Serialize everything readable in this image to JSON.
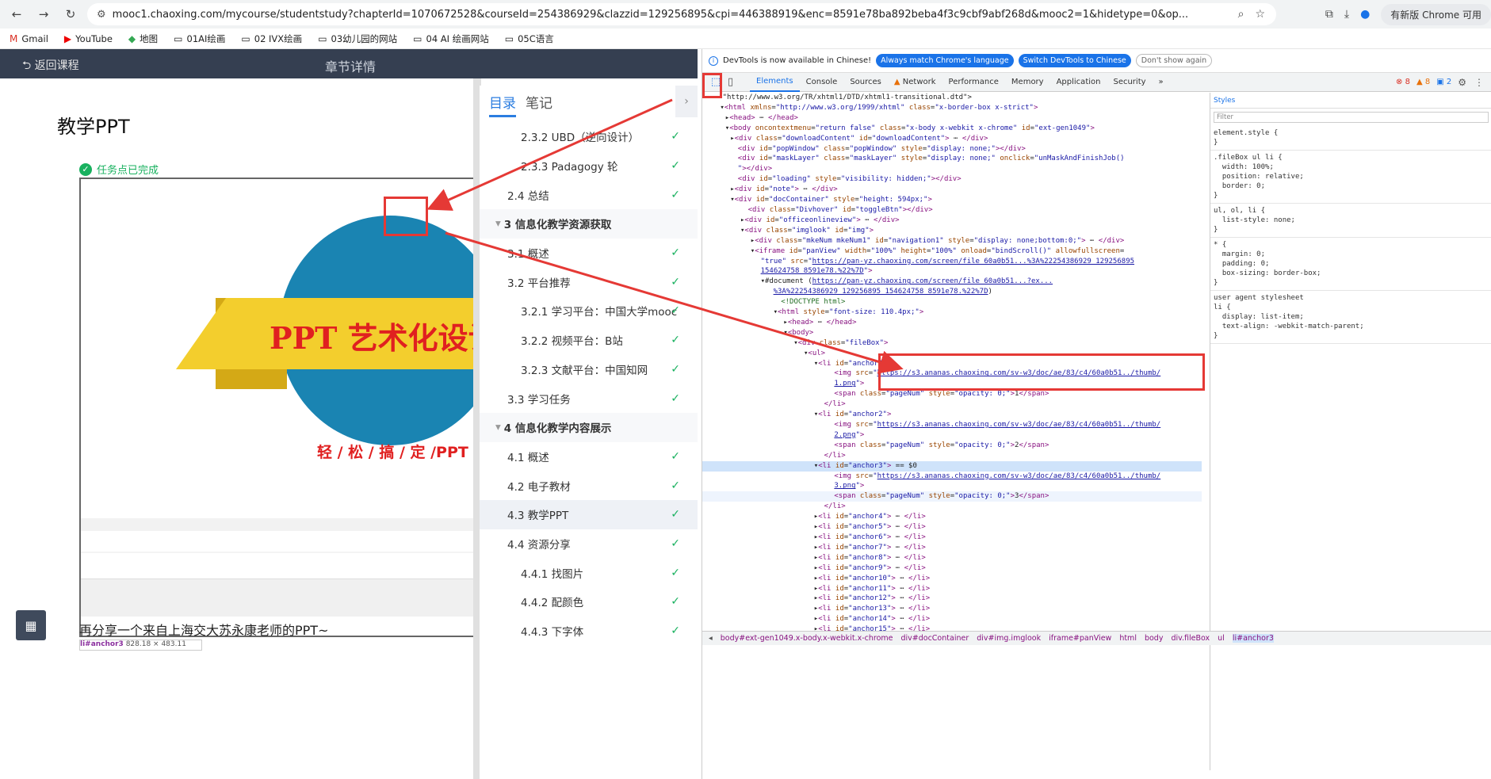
{
  "browser": {
    "url": "mooc1.chaoxing.com/mycourse/studentstudy?chapterId=1070672528&courseId=254386929&clazzid=129256895&cpi=446388919&enc=8591e78ba892beba4f3c9cbf9abf268d&mooc2=1&hidetype=0&op...",
    "chrome_update": "有新版 Chrome 可用",
    "bookmarks": [
      "Gmail",
      "YouTube",
      "地图",
      "01AI绘画",
      "02 IVX绘画",
      "03幼儿园的网站",
      "04 AI 绘画网站",
      "05C语言"
    ]
  },
  "course": {
    "back_label": "返回课程",
    "header_title": "章节详情",
    "page_title": "教学PPT",
    "task_status": "任务点已完成",
    "slide_title": "PPT 艺术化设计",
    "slide_tagline": "轻 / 松 / 搞 / 定 /PPT",
    "next_text": "再分享一个来自上海交大苏永康老师的PPT~",
    "hover_tag_name": "li#anchor3",
    "hover_tag_size": "828.18 × 483.11"
  },
  "catalog": {
    "tab_active": "目录",
    "tab_notes": "笔记",
    "items": [
      {
        "label": "2.3.2 UBD（逆向设计）",
        "level": 3,
        "done": true
      },
      {
        "label": "2.3.3 Padagogy 轮",
        "level": 3,
        "done": true
      },
      {
        "label": "2.4 总结",
        "level": 2,
        "done": true
      },
      {
        "label": "3 信息化教学资源获取",
        "level": 1,
        "done": false
      },
      {
        "label": "3.1 概述",
        "level": 2,
        "done": true
      },
      {
        "label": "3.2 平台推荐",
        "level": 2,
        "done": true
      },
      {
        "label": "3.2.1 学习平台：中国大学mooc",
        "level": 3,
        "done": true
      },
      {
        "label": "3.2.2 视频平台：B站",
        "level": 3,
        "done": true
      },
      {
        "label": "3.2.3 文献平台：中国知网",
        "level": 3,
        "done": true
      },
      {
        "label": "3.3 学习任务",
        "level": 2,
        "done": true
      },
      {
        "label": "4 信息化教学内容展示",
        "level": 1,
        "done": false
      },
      {
        "label": "4.1 概述",
        "level": 2,
        "done": true
      },
      {
        "label": "4.2 电子教材",
        "level": 2,
        "done": true
      },
      {
        "label": "4.3 教学PPT",
        "level": 2,
        "done": true,
        "active": true
      },
      {
        "label": "4.4 资源分享",
        "level": 2,
        "done": true
      },
      {
        "label": "4.4.1 找图片",
        "level": 3,
        "done": true
      },
      {
        "label": "4.4.2 配颜色",
        "level": 3,
        "done": true
      },
      {
        "label": "4.4.3 下字体",
        "level": 3,
        "done": true
      }
    ]
  },
  "devtools": {
    "info_text": "DevTools is now available in Chinese!",
    "btn_match": "Always match Chrome's language",
    "btn_switch": "Switch DevTools to Chinese",
    "btn_dont": "Don't show again",
    "tabs": [
      "Elements",
      "Console",
      "Sources",
      "Network",
      "Performance",
      "Memory",
      "Application",
      "Security"
    ],
    "errors": "8",
    "warnings": "8",
    "infos": "2",
    "styles_tab": "Styles",
    "filter_placeholder": "Filter",
    "breadcrumbs": [
      "body#ext-gen1049.x-body.x-webkit.x-chrome",
      "div#docContainer",
      "div#img.imglook",
      "iframe#panView",
      "html",
      "body",
      "div.fileBox",
      "ul",
      "li#anchor3"
    ],
    "dom_lines": [
      {
        "i": 16,
        "html": "<span class='txt'>\"http://www.w3.org/TR/xhtml1/DTD/xhtml1-transitional.dtd\"&gt;</span>"
      },
      {
        "i": 14,
        "html": "▾<span class='tag'>&lt;html</span> <span class='attr'>xmlns</span>=<span class='val'>\"http://www.w3.org/1999/xhtml\"</span> <span class='attr'>class</span>=<span class='val'>\"x-border-box x-strict\"</span><span class='tag'>&gt;</span>"
      },
      {
        "i": 18,
        "html": "▸<span class='tag'>&lt;head&gt;</span> ⋯ <span class='tag'>&lt;/head&gt;</span>"
      },
      {
        "i": 18,
        "html": "▾<span class='tag'>&lt;body</span> <span class='attr'>oncontextmenu</span>=<span class='val'>\"return false\"</span> <span class='attr'>class</span>=<span class='val'>\"x-body x-webkit x-chrome\"</span> <span class='attr'>id</span>=<span class='val'>\"ext-gen1049\"</span><span class='tag'>&gt;</span>"
      },
      {
        "i": 22,
        "html": "▸<span class='tag'>&lt;div</span> <span class='attr'>class</span>=<span class='val'>\"downloadContent\"</span> <span class='attr'>id</span>=<span class='val'>\"downloadContent\"</span><span class='tag'>&gt;</span> ⋯ <span class='tag'>&lt;/div&gt;</span>"
      },
      {
        "i": 28,
        "html": "<span class='tag'>&lt;div</span> <span class='attr'>id</span>=<span class='val'>\"popWindow\"</span> <span class='attr'>class</span>=<span class='val'>\"popWindow\"</span> <span class='attr'>style</span>=<span class='val'>\"display: none;\"</span><span class='tag'>&gt;&lt;/div&gt;</span>"
      },
      {
        "i": 28,
        "html": "<span class='tag'>&lt;div</span> <span class='attr'>id</span>=<span class='val'>\"maskLayer\"</span> <span class='attr'>class</span>=<span class='val'>\"maskLayer\"</span> <span class='attr'>style</span>=<span class='val'>\"display: none;\"</span> <span class='attr'>onclick</span>=<span class='val'>\"unMaskAndFinishJob()</span>"
      },
      {
        "i": 28,
        "html": "<span class='val'>\"</span><span class='tag'>&gt;&lt;/div&gt;</span>"
      },
      {
        "i": 28,
        "html": "<span class='tag'>&lt;div</span> <span class='attr'>id</span>=<span class='val'>\"loading\"</span> <span class='attr'>style</span>=<span class='val'>\"visibility: hidden;\"</span><span class='tag'>&gt;&lt;/div&gt;</span>"
      },
      {
        "i": 22,
        "html": "▸<span class='tag'>&lt;div</span> <span class='attr'>id</span>=<span class='val'>\"note\"</span><span class='tag'>&gt;</span> ⋯ <span class='tag'>&lt;/div&gt;</span>"
      },
      {
        "i": 22,
        "html": "▾<span class='tag'>&lt;div</span> <span class='attr'>id</span>=<span class='val'>\"docContainer\"</span> <span class='attr'>style</span>=<span class='val'>\"height: 594px;\"</span><span class='tag'>&gt;</span>"
      },
      {
        "i": 36,
        "html": "<span class='tag'>&lt;div</span> <span class='attr'>class</span>=<span class='val'>\"Divhover\"</span> <span class='attr'>id</span>=<span class='val'>\"toggleBtn\"</span><span class='tag'>&gt;&lt;/div&gt;</span>"
      },
      {
        "i": 30,
        "html": "▸<span class='tag'>&lt;div</span> <span class='attr'>id</span>=<span class='val'>\"officeonlineview\"</span><span class='tag'>&gt;</span> ⋯ <span class='tag'>&lt;/div&gt;</span>"
      },
      {
        "i": 30,
        "html": "▾<span class='tag'>&lt;div</span> <span class='attr'>class</span>=<span class='val'>\"imglook\"</span> <span class='attr'>id</span>=<span class='val'>\"img\"</span><span class='tag'>&gt;</span>"
      },
      {
        "i": 38,
        "html": "▸<span class='tag'>&lt;div</span> <span class='attr'>class</span>=<span class='val'>\"mkeNum mkeNum1\"</span> <span class='attr'>id</span>=<span class='val'>\"navigation1\"</span> <span class='attr'>style</span>=<span class='val'>\"display: none;bottom:0;\"</span><span class='tag'>&gt;</span> ⋯ <span class='tag'>&lt;/div&gt;</span>"
      },
      {
        "i": 38,
        "html": "▾<span class='tag'>&lt;iframe</span> <span class='attr'>id</span>=<span class='val'>\"panView\"</span> <span class='attr'>width</span>=<span class='val'>\"100%\"</span> <span class='attr'>height</span>=<span class='val'>\"100%\"</span> <span class='attr'>onload</span>=<span class='val'>\"bindScroll()\"</span> <span class='attr'>allowfullscreen</span>="
      },
      {
        "i": 46,
        "html": "<span class='val'>\"true\"</span> <span class='attr'>src</span>=<span class='val'>\"</span><span class='link'>https://pan-yz.chaoxing.com/screen/file_60a0b51...%3A%22254386929_129256895</span>"
      },
      {
        "i": 46,
        "html": "<span class='link'>154624758_8591e78.%22%7D</span><span class='val'>\"</span><span class='tag'>&gt;</span>"
      },
      {
        "i": 46,
        "html": "▾<span class='txt'>#document</span> (<span class='link'>https://pan-yz.chaoxing.com/screen/file_60a0b51...?ex...</span>"
      },
      {
        "i": 56,
        "html": "<span class='link'>%3A%22254386929_129256895_154624758_8591e78.%22%7D</span>)"
      },
      {
        "i": 62,
        "html": "<span class='cmt'>&lt;!DOCTYPE html&gt;</span>"
      },
      {
        "i": 56,
        "html": "▾<span class='tag'>&lt;html</span> <span class='attr'>style</span>=<span class='val'>\"font-size: 110.4px;\"</span><span class='tag'>&gt;</span>"
      },
      {
        "i": 64,
        "html": "▸<span class='tag'>&lt;head&gt;</span> ⋯ <span class='tag'>&lt;/head&gt;</span>"
      },
      {
        "i": 64,
        "html": "▾<span class='tag'>&lt;body&gt;</span>"
      },
      {
        "i": 72,
        "html": "▾<span class='tag'>&lt;div</span> <span class='attr'>class</span>=<span class='val'>\"fileBox\"</span><span class='tag'>&gt;</span>"
      },
      {
        "i": 80,
        "html": "▾<span class='tag'>&lt;ul&gt;</span>"
      },
      {
        "i": 88,
        "html": "▾<span class='tag'>&lt;li</span> <span class='attr'>id</span>=<span class='val'>\"anchor1\"</span><span class='tag'>&gt;</span>"
      },
      {
        "i": 104,
        "html": "<span class='tag'>&lt;img</span> <span class='attr'>src</span>=<span class='val'>\"</span><span class='link'>https://s3.ananas.chaoxing.com/sv-w3/doc/ae/83/c4/60a0b51../thumb/</span>"
      },
      {
        "i": 104,
        "html": "<span class='link'>1.png</span><span class='val'>\"</span><span class='tag'>&gt;</span>"
      },
      {
        "i": 104,
        "html": "<span class='tag'>&lt;span</span> <span class='attr'>class</span>=<span class='val'>\"pageNum\"</span> <span class='attr'>style</span>=<span class='val'>\"opacity: 0;\"</span><span class='tag'>&gt;</span>1<span class='tag'>&lt;/span&gt;</span>"
      },
      {
        "i": 96,
        "html": "<span class='tag'>&lt;/li&gt;</span>"
      },
      {
        "i": 88,
        "html": "▾<span class='tag'>&lt;li</span> <span class='attr'>id</span>=<span class='val'>\"anchor2\"</span><span class='tag'>&gt;</span>"
      },
      {
        "i": 104,
        "html": "<span class='tag'>&lt;img</span> <span class='attr'>src</span>=<span class='val'>\"</span><span class='link'>https://s3.ananas.chaoxing.com/sv-w3/doc/ae/83/c4/60a0b51../thumb/</span>"
      },
      {
        "i": 104,
        "html": "<span class='link'>2.png</span><span class='val'>\"</span><span class='tag'>&gt;</span>"
      },
      {
        "i": 104,
        "html": "<span class='tag'>&lt;span</span> <span class='attr'>class</span>=<span class='val'>\"pageNum\"</span> <span class='attr'>style</span>=<span class='val'>\"opacity: 0;\"</span><span class='tag'>&gt;</span>2<span class='tag'>&lt;/span&gt;</span>"
      },
      {
        "i": 96,
        "html": "<span class='tag'>&lt;/li&gt;</span>"
      },
      {
        "i": 88,
        "html": "▾<span class='tag'>&lt;li</span> <span class='attr'>id</span>=<span class='val'>\"anchor3\"</span><span class='tag'>&gt;</span> == $0",
        "sel": true
      },
      {
        "i": 104,
        "html": "<span class='tag'>&lt;img</span> <span class='attr'>src</span>=<span class='val'>\"</span><span class='link'>https://s3.ananas.chaoxing.com/sv-w3/doc/ae/83/c4/60a0b51../thumb/</span>"
      },
      {
        "i": 104,
        "html": "<span class='link'>3.png</span><span class='val'>\"</span><span class='tag'>&gt;</span>"
      },
      {
        "i": 104,
        "html": "<span class='tag'>&lt;span</span> <span class='attr'>class</span>=<span class='val'>\"pageNum\"</span> <span class='attr'>style</span>=<span class='val'>\"opacity: 0;\"</span><span class='tag'>&gt;</span>3<span class='tag'>&lt;/span&gt;</span>",
        "hov": true
      },
      {
        "i": 96,
        "html": "<span class='tag'>&lt;/li&gt;</span>"
      },
      {
        "i": 88,
        "html": "▸<span class='tag'>&lt;li</span> <span class='attr'>id</span>=<span class='val'>\"anchor4\"</span><span class='tag'>&gt;</span> ⋯ <span class='tag'>&lt;/li&gt;</span>"
      },
      {
        "i": 88,
        "html": "▸<span class='tag'>&lt;li</span> <span class='attr'>id</span>=<span class='val'>\"anchor5\"</span><span class='tag'>&gt;</span> ⋯ <span class='tag'>&lt;/li&gt;</span>"
      },
      {
        "i": 88,
        "html": "▸<span class='tag'>&lt;li</span> <span class='attr'>id</span>=<span class='val'>\"anchor6\"</span><span class='tag'>&gt;</span> ⋯ <span class='tag'>&lt;/li&gt;</span>"
      },
      {
        "i": 88,
        "html": "▸<span class='tag'>&lt;li</span> <span class='attr'>id</span>=<span class='val'>\"anchor7\"</span><span class='tag'>&gt;</span> ⋯ <span class='tag'>&lt;/li&gt;</span>"
      },
      {
        "i": 88,
        "html": "▸<span class='tag'>&lt;li</span> <span class='attr'>id</span>=<span class='val'>\"anchor8\"</span><span class='tag'>&gt;</span> ⋯ <span class='tag'>&lt;/li&gt;</span>"
      },
      {
        "i": 88,
        "html": "▸<span class='tag'>&lt;li</span> <span class='attr'>id</span>=<span class='val'>\"anchor9\"</span><span class='tag'>&gt;</span> ⋯ <span class='tag'>&lt;/li&gt;</span>"
      },
      {
        "i": 88,
        "html": "▸<span class='tag'>&lt;li</span> <span class='attr'>id</span>=<span class='val'>\"anchor10\"</span><span class='tag'>&gt;</span> ⋯ <span class='tag'>&lt;/li&gt;</span>"
      },
      {
        "i": 88,
        "html": "▸<span class='tag'>&lt;li</span> <span class='attr'>id</span>=<span class='val'>\"anchor11\"</span><span class='tag'>&gt;</span> ⋯ <span class='tag'>&lt;/li&gt;</span>"
      },
      {
        "i": 88,
        "html": "▸<span class='tag'>&lt;li</span> <span class='attr'>id</span>=<span class='val'>\"anchor12\"</span><span class='tag'>&gt;</span> ⋯ <span class='tag'>&lt;/li&gt;</span>"
      },
      {
        "i": 88,
        "html": "▸<span class='tag'>&lt;li</span> <span class='attr'>id</span>=<span class='val'>\"anchor13\"</span><span class='tag'>&gt;</span> ⋯ <span class='tag'>&lt;/li&gt;</span>"
      },
      {
        "i": 88,
        "html": "▸<span class='tag'>&lt;li</span> <span class='attr'>id</span>=<span class='val'>\"anchor14\"</span><span class='tag'>&gt;</span> ⋯ <span class='tag'>&lt;/li&gt;</span>"
      },
      {
        "i": 88,
        "html": "▸<span class='tag'>&lt;li</span> <span class='attr'>id</span>=<span class='val'>\"anchor15\"</span><span class='tag'>&gt;</span> ⋯ <span class='tag'>&lt;/li&gt;</span>"
      }
    ],
    "styles_rules": [
      "element.style {\n}",
      ".fileBox ul li {\n  width: 100%;\n  position: relative;\n  border: 0;\n}",
      "ul, ol, li {\n  list-style: none;\n}",
      "* {\n  margin: 0;\n  padding: 0;\n  box-sizing: border-box;\n}",
      "user agent stylesheet\nli {\n  display: list-item;\n  text-align: -webkit-match-parent;\n}"
    ]
  }
}
